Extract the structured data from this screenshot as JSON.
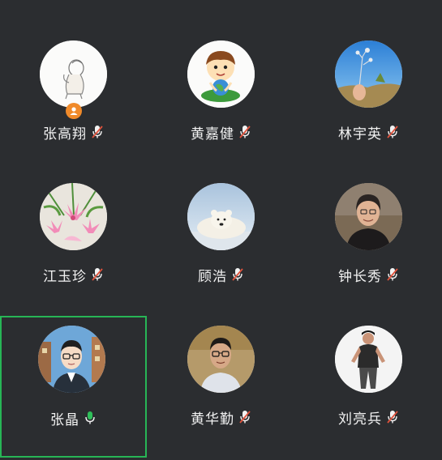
{
  "participants": [
    {
      "name": "张高翔",
      "mic": "muted",
      "host": true,
      "avatar_icon": "sketch-drawing-avatar-icon"
    },
    {
      "name": "黄嘉健",
      "mic": "muted",
      "host": false,
      "avatar_icon": "cartoon-boy-globe-avatar-icon"
    },
    {
      "name": "林宇英",
      "mic": "muted",
      "host": false,
      "avatar_icon": "sky-flowers-avatar-icon"
    },
    {
      "name": "江玉珍",
      "mic": "muted",
      "host": false,
      "avatar_icon": "lily-flowers-avatar-icon"
    },
    {
      "name": "顾浩",
      "mic": "muted",
      "host": false,
      "avatar_icon": "polar-bear-avatar-icon"
    },
    {
      "name": "钟长秀",
      "mic": "muted",
      "host": false,
      "avatar_icon": "woman-photo-avatar-icon"
    },
    {
      "name": "张晶",
      "mic": "on",
      "host": false,
      "active": true,
      "avatar_icon": "cartoon-man-glasses-avatar-icon"
    },
    {
      "name": "黄华勤",
      "mic": "muted",
      "host": false,
      "avatar_icon": "man-glasses-photo-avatar-icon"
    },
    {
      "name": "刘亮兵",
      "mic": "muted",
      "host": false,
      "avatar_icon": "man-standing-photo-avatar-icon"
    }
  ],
  "colors": {
    "background": "#2b2d30",
    "active_border": "#27b556",
    "mic_on": "#2fbf5a",
    "mic_muted_slash": "#e0533d",
    "host_badge": "#f08a2a"
  }
}
